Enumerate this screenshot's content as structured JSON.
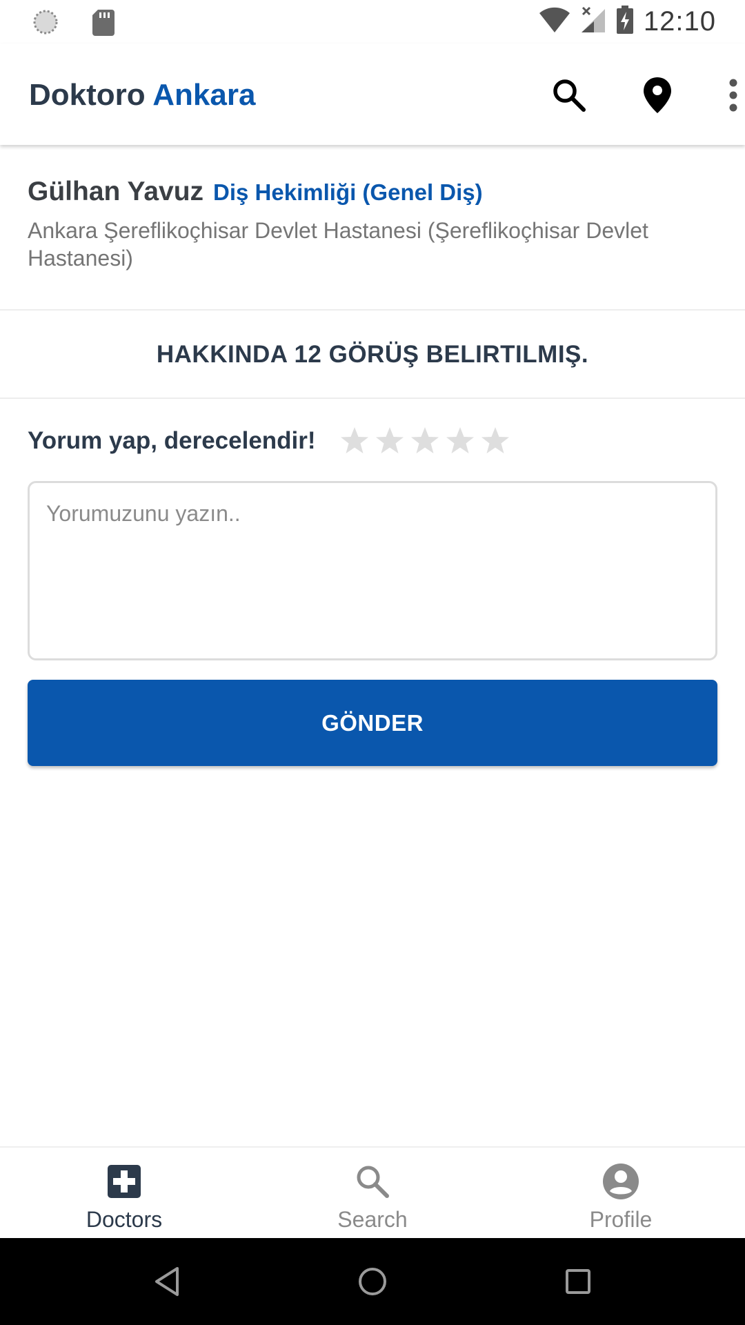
{
  "status_bar": {
    "time": "12:10",
    "icons": [
      "sync-icon",
      "sd-card-icon",
      "wifi-icon",
      "signal-icon",
      "battery-charging-icon"
    ]
  },
  "app_bar": {
    "title_part1": "Doktoro",
    "title_part2": "Ankara",
    "actions": [
      "search-icon",
      "location-pin-icon",
      "more-vert-icon"
    ]
  },
  "doctor": {
    "name": "Gülhan Yavuz",
    "specialty": "Diş Hekimliği (Genel Diş)",
    "hospital": "Ankara Şereflikoçhisar Devlet Hastanesi (Şereflikoçhisar Devlet Hastanesi)"
  },
  "reviews": {
    "count_text": "HAKKINDA 12 GÖRÜŞ BELIRTILMIŞ."
  },
  "comment_form": {
    "rate_label": "Yorum yap, derecelendir!",
    "rating": 0,
    "max_rating": 5,
    "placeholder": "Yorumuzunu yazın..",
    "value": "",
    "submit_label": "GÖNDER"
  },
  "bottom_nav": {
    "items": [
      {
        "label": "Doctors",
        "icon": "medical-cross-icon",
        "active": true
      },
      {
        "label": "Search",
        "icon": "search-icon",
        "active": false
      },
      {
        "label": "Profile",
        "icon": "account-circle-icon",
        "active": false
      }
    ]
  },
  "colors": {
    "primary": "#0a57ad",
    "text_dark": "#2c3a4b",
    "text_muted": "#757575",
    "star_empty": "#dedede"
  }
}
